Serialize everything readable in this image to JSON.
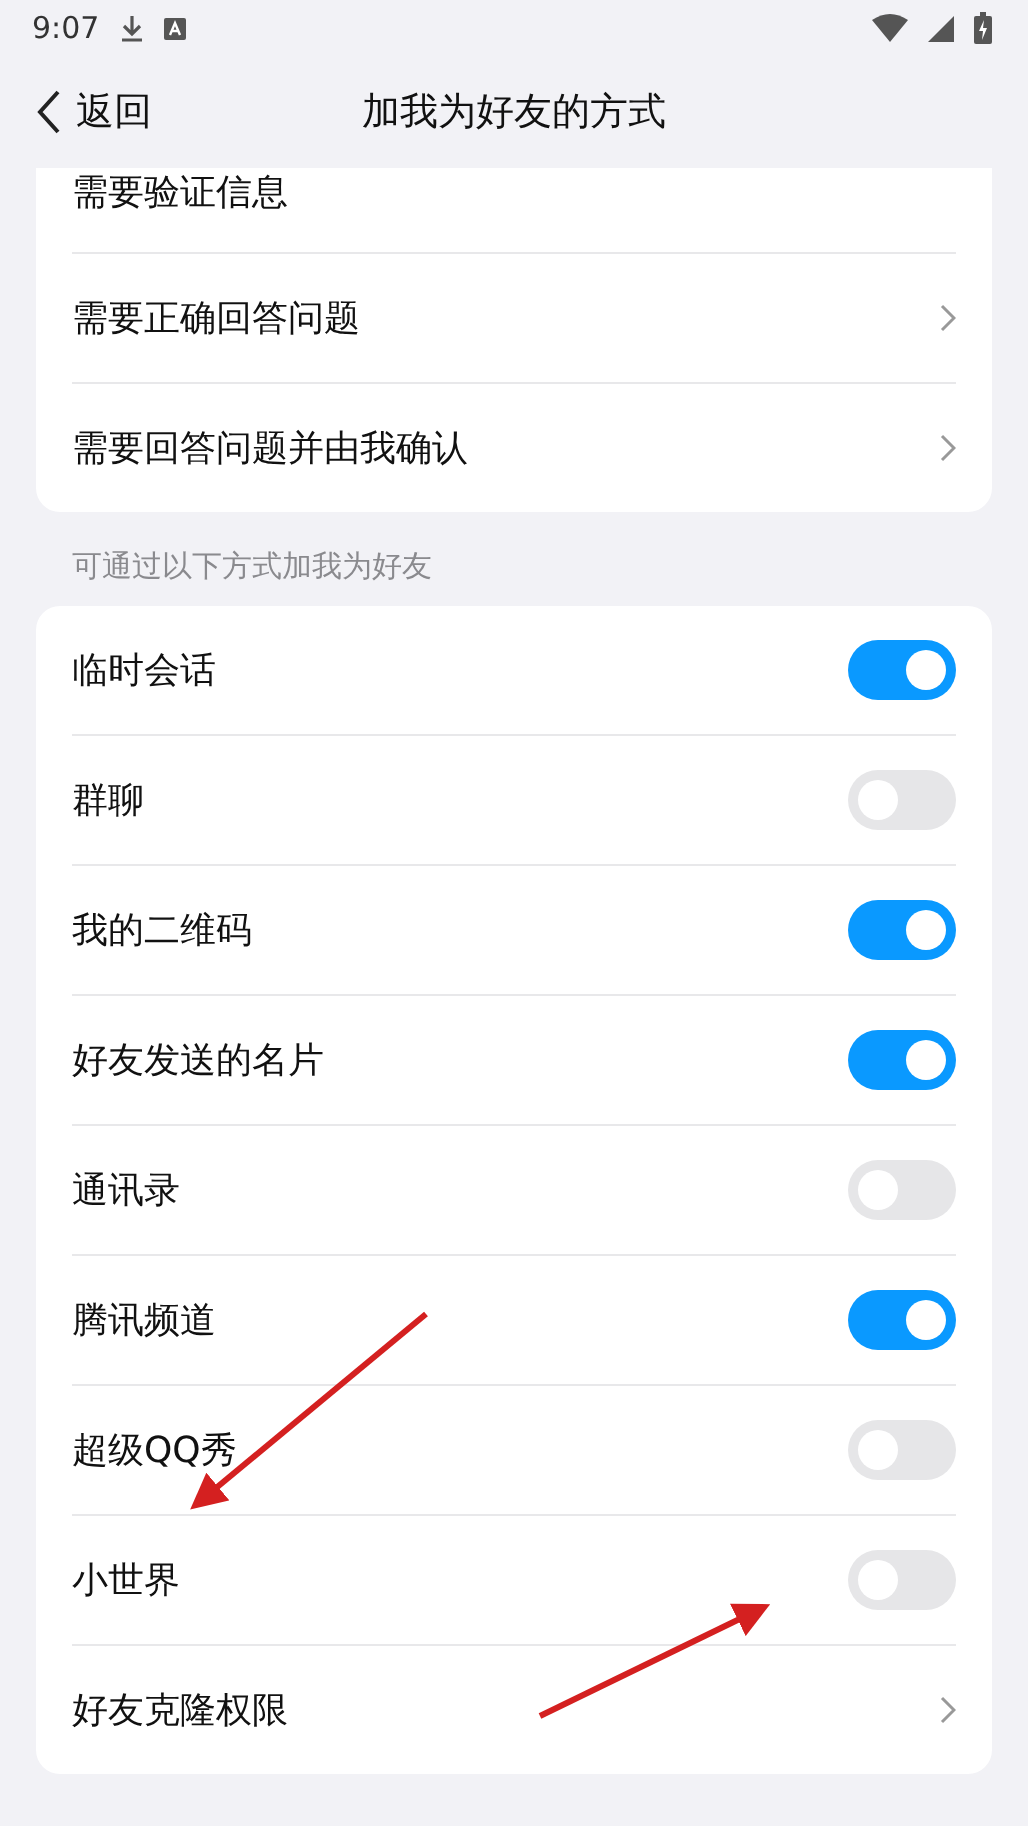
{
  "status_bar": {
    "time": "9:07"
  },
  "header": {
    "back": "返回",
    "title": "加我为好友的方式"
  },
  "verify_options": [
    {
      "label": "需要验证信息",
      "kind": "plain"
    },
    {
      "label": "需要正确回答问题",
      "kind": "link"
    },
    {
      "label": "需要回答问题并由我确认",
      "kind": "link"
    }
  ],
  "section_label": "可通过以下方式加我为好友",
  "ways": [
    {
      "label": "临时会话",
      "kind": "toggle",
      "on": true
    },
    {
      "label": "群聊",
      "kind": "toggle",
      "on": false
    },
    {
      "label": "我的二维码",
      "kind": "toggle",
      "on": true
    },
    {
      "label": "好友发送的名片",
      "kind": "toggle",
      "on": true
    },
    {
      "label": "通讯录",
      "kind": "toggle",
      "on": false
    },
    {
      "label": "腾讯频道",
      "kind": "toggle",
      "on": true
    },
    {
      "label": "超级QQ秀",
      "kind": "toggle",
      "on": false
    },
    {
      "label": "小世界",
      "kind": "toggle",
      "on": false
    },
    {
      "label": "好友克隆权限",
      "kind": "link"
    }
  ]
}
